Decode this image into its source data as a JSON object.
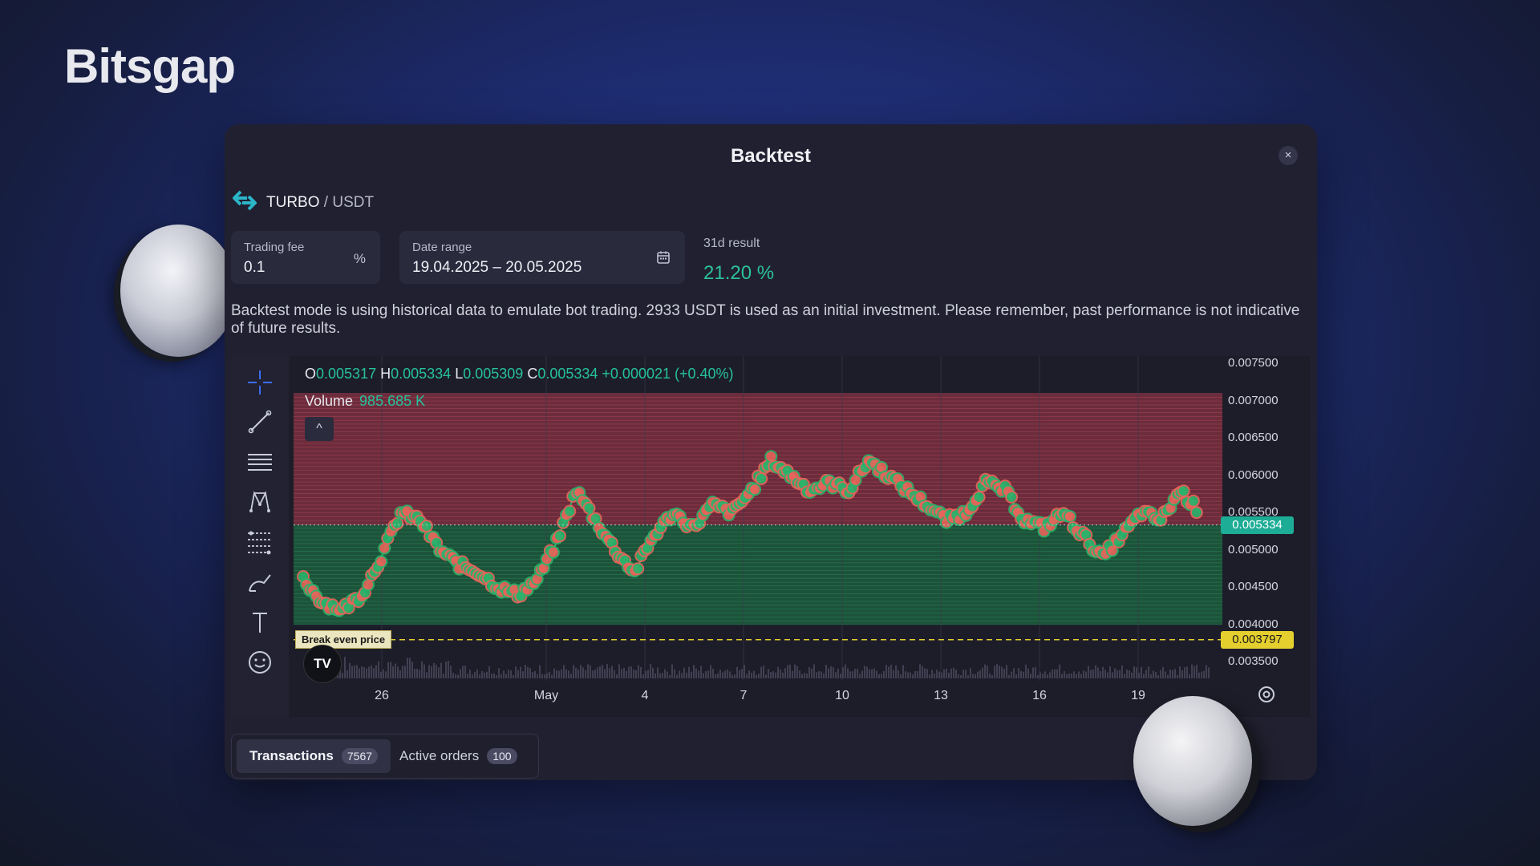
{
  "brand": {
    "logo_text": "Bitsgap"
  },
  "modal": {
    "title": "Backtest",
    "close_label": "×",
    "pair": {
      "base": "TURBO",
      "separator": " / ",
      "quote": "USDT"
    },
    "trading_fee": {
      "label": "Trading fee",
      "value": "0.1",
      "unit": "%"
    },
    "date_range": {
      "label": "Date range",
      "value": "19.04.2025 – 20.05.2025"
    },
    "result": {
      "label": "31d result",
      "value": "21.20 %"
    },
    "note": "Backtest mode is using historical data to emulate bot trading. 2933 USDT is used as an initial investment. Please remember, past performance is not indicative of future results."
  },
  "chart": {
    "legend": {
      "o_label": "O",
      "o_value": "0.005317",
      "h_label": "H",
      "h_value": "0.005334",
      "l_label": "L",
      "l_value": "0.005309",
      "c_label": "C",
      "c_value": "0.005334",
      "change": "+0.000021 (+0.40%)"
    },
    "volume": {
      "label": "Volume",
      "value": "985.685 K"
    },
    "collapse_label": "^",
    "price_tag": "0.005334",
    "break_even_tag": "0.003797",
    "break_even_label": "Break even price",
    "tv_logo": "TV",
    "toolbar_icons": [
      "crosshair-icon",
      "trendline-icon",
      "horizontal-lines-icon",
      "pattern-icon",
      "fib-icon",
      "brush-icon",
      "text-icon",
      "emoji-icon"
    ]
  },
  "chart_data": {
    "type": "line",
    "title": "",
    "xlabel": "",
    "ylabel": "",
    "x_ticks": [
      "26",
      "May",
      "4",
      "7",
      "10",
      "13",
      "16",
      "19"
    ],
    "y_ticks": [
      "0.007500",
      "0.007000",
      "0.006500",
      "0.006000",
      "0.005500",
      "0.005000",
      "0.004500",
      "0.004000",
      "0.003500"
    ],
    "ylim": [
      0.0033,
      0.0076
    ],
    "current_price": 0.005334,
    "break_even_price": 0.003797,
    "grid_top": 0.0071,
    "grid_bottom": 0.004,
    "series": [
      {
        "values": [
          0.0046,
          0.0043,
          0.0042,
          0.0044,
          0.0049,
          0.0055,
          0.0054,
          0.005,
          0.0048,
          0.0047,
          0.0045,
          0.0044,
          0.0046,
          0.0051,
          0.0058,
          0.0054,
          0.005,
          0.0047,
          0.0052,
          0.0055,
          0.0053,
          0.0056,
          0.0055,
          0.0058,
          0.0062,
          0.006,
          0.0058,
          0.0059,
          0.0058,
          0.0062,
          0.006,
          0.0058,
          0.0056,
          0.0054,
          0.0055,
          0.0059,
          0.0058,
          0.0054,
          0.0053,
          0.0055,
          0.0052,
          0.0049,
          0.0052,
          0.0055,
          0.0054,
          0.0058,
          0.0055
        ]
      }
    ],
    "colors": {
      "up": "#2bb36b",
      "down": "#e8645a",
      "sell_zone": "#7a2f3e",
      "buy_zone": "#1d5a3c",
      "accent": "#2bc29a",
      "break_even": "#e4cf2f"
    }
  },
  "tabs": [
    {
      "label": "Transactions",
      "count": "7567"
    },
    {
      "label": "Active orders",
      "count": "100"
    }
  ]
}
